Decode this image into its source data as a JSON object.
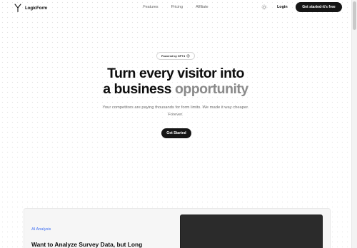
{
  "brand": {
    "name": "LogicForm",
    "logo_icon": "y-shape-logo-icon"
  },
  "nav": {
    "links": [
      "Features",
      "Pricing",
      "Affiliate"
    ],
    "theme_icon": "sun-icon",
    "login_label": "Login",
    "cta_label": "Get started-it's free"
  },
  "hero": {
    "badge_text": "Powered by GPT4",
    "badge_icon": "openai-icon",
    "title_line1": "Turn every visitor into",
    "title_line2_dark": "a business ",
    "title_line2_faded": "opportunity",
    "subtitle": "Your competitors are paying thousands for form limits. We made it way cheaper. Forever.",
    "cta_label": "Get Started"
  },
  "feature": {
    "tag": "AI Analysis",
    "heading": "Want to Analyze Survey Data, but Long"
  },
  "colors": {
    "primary_button": "#161616",
    "accent_link": "#3b6cf2",
    "muted_text": "#6d6d6d"
  }
}
